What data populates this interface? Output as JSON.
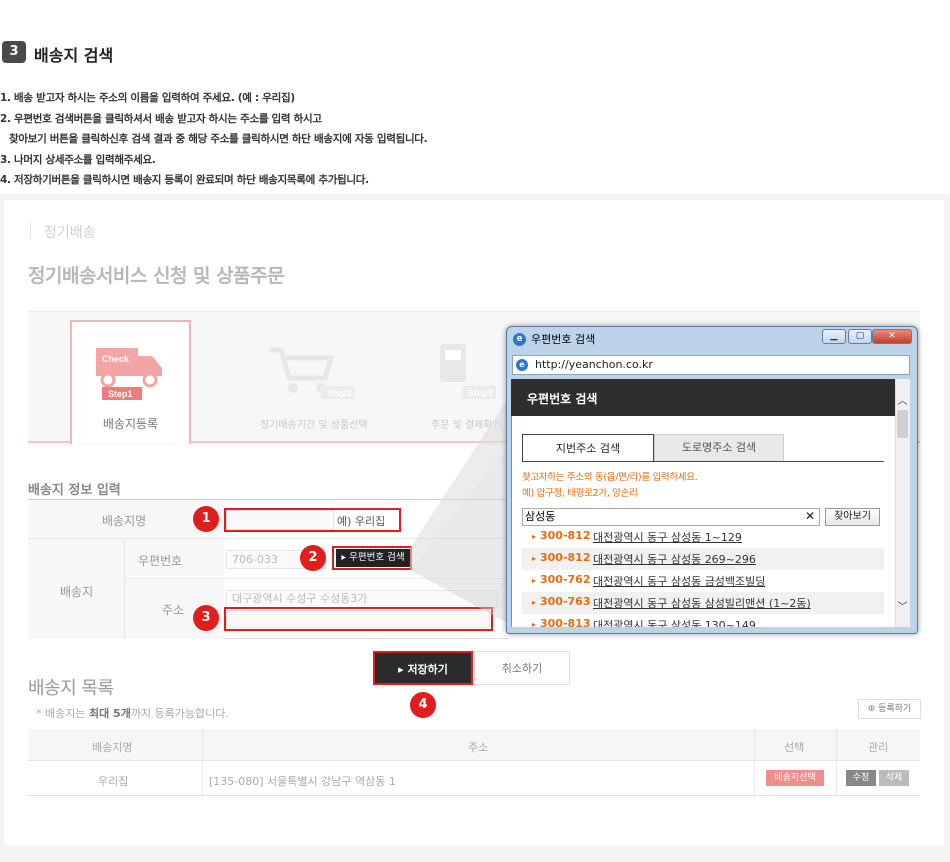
{
  "guide": {
    "badge": "3",
    "title": "배송지 검색",
    "lines": [
      "1. 배송 받고자 하시는 주소의 이름을 입력하여 주세요. (예 : 우리집)",
      "2. 우편번호 검색버튼을 클릭하셔서 배송 받고자 하시는 주소를 입력 하시고",
      "찾아보기 버튼을 클릭하신후 검색 결과 중 해당 주소를 클릭하시면 하단 배송지에 자동 입력됩니다.",
      "3. 나머지 상세주소를 입력해주세요.",
      "4. 저장하기버튼을 클릭하시면 배송지 등록이 완료되며 하단 배송지목록에 추가됩니다."
    ]
  },
  "page": {
    "breadcrumb": "정기배송",
    "title": "정기배송서비스 신청 및 상품주문"
  },
  "steps": [
    {
      "icon_text": "Check",
      "step": "Step1",
      "label": "배송지등록"
    },
    {
      "step": "Step2",
      "label": "정기배송기간 및 상품선택"
    },
    {
      "step": "Step3",
      "label": "주문 및 결제확인"
    }
  ],
  "form": {
    "section_title": "배송지 정보 입력",
    "name_label": "배송지명",
    "name_example": "예) 우리집",
    "address_group_label": "배송지",
    "zip_label": "우편번호",
    "zip_value": "706-033",
    "zip_button": "우편번호 검색",
    "addr_label": "주소",
    "addr_value": "대구광역시 수성구 수성동3가",
    "markers": [
      "1",
      "2",
      "3",
      "4"
    ],
    "save_button": "저장하기",
    "cancel_button": "취소하기"
  },
  "list": {
    "title": "배송지 목록",
    "note_prefix": "* 배송지는 ",
    "note_bold": "최대 5개",
    "note_suffix": "까지 등록가능합니다.",
    "register_button": "등록하기",
    "columns": [
      "배송지명",
      "주소",
      "선택",
      "관리"
    ],
    "rows": [
      {
        "name": "우리집",
        "address": "[135-080] 서울특별시 강남구 역삼동 1",
        "select": "배송지선택",
        "edit": "수정",
        "delete": "삭제"
      }
    ]
  },
  "popup": {
    "window_title": "우편번호 검색",
    "url": "http://yeanchon.co.kr",
    "header": "우편번호 검색",
    "tab_active": "지번주소 검색",
    "tab_inactive": "도로명주소 검색",
    "hint1": "찾고자하는 주소의 동(읍/면/리)를 입력하세요.",
    "hint2": "예) 압구정, 태평로2가, 양손리",
    "search_value": "삼성동",
    "search_button": "찾아보기",
    "results": [
      {
        "zip": "300-812",
        "addr": "대전광역시 동구 삼성동 1~129"
      },
      {
        "zip": "300-812",
        "addr": "대전광역시 동구 삼성동 269~296"
      },
      {
        "zip": "300-762",
        "addr": "대전광역시 동구 삼성동 금성백조빌딩"
      },
      {
        "zip": "300-763",
        "addr": "대전광역시 동구 삼성동 삼성빌리맨션 (1~2동)"
      },
      {
        "zip": "300-813",
        "addr": "대전광역시 동구 삼성동 130~149"
      }
    ]
  },
  "colors": {
    "highlight": "#e21d1d",
    "accent_orange": "#e56c10",
    "dark": "#2b2b2b"
  }
}
